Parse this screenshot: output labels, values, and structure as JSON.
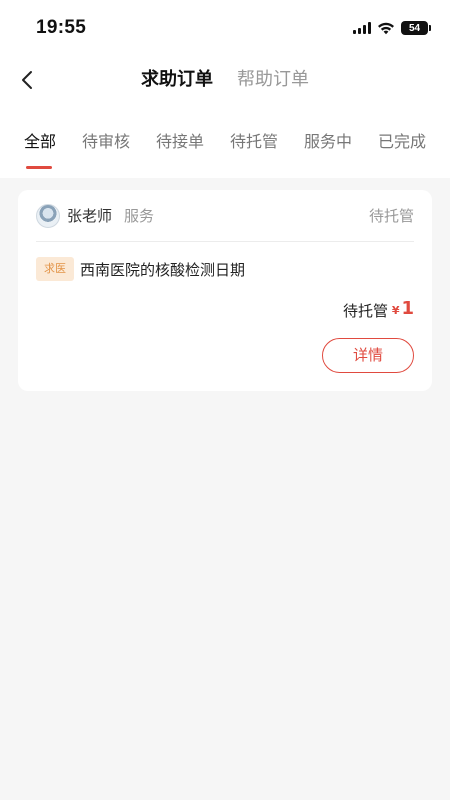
{
  "status_bar": {
    "time": "19:55",
    "battery": "54"
  },
  "nav": {
    "back_icon": "chevron-left-icon",
    "tabs": [
      {
        "label": "求助订单",
        "active": true
      },
      {
        "label": "帮助订单",
        "active": false
      }
    ]
  },
  "filters": {
    "tabs": [
      "全部",
      "待审核",
      "待接单",
      "待托管",
      "服务中",
      "已完成"
    ],
    "active_index": 0
  },
  "orders": [
    {
      "user_name": "张老师",
      "service_label": "服务",
      "header_status": "待托管",
      "type_tag": "求医",
      "title": "西南医院的核酸检测日期",
      "status": "待托管",
      "currency": "¥",
      "amount": "1",
      "detail_label": "详情"
    }
  ],
  "colors": {
    "accent": "#e04a3f",
    "tag_bg": "#fbe9d6",
    "tag_text": "#e39448",
    "page_bg": "#f6f6f6"
  }
}
